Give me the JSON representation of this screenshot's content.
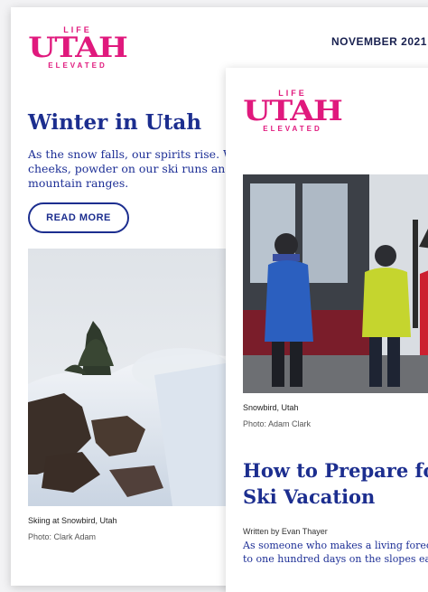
{
  "brand": {
    "life": "LIFE",
    "name": "UTAH",
    "tagline": "ELEVATED"
  },
  "newsletter": {
    "date": "NOVEMBER 2021",
    "title": "Winter in Utah",
    "intro": "As the snow falls, our spirits rise. We cheeks, powder on our ski runs and a mountain ranges.",
    "read_more": "READ MORE",
    "photo_caption": "Skiing at Snowbird, Utah",
    "photo_credit": "Photo: Clark Adam"
  },
  "article": {
    "photo_caption": "Snowbird, Utah",
    "photo_credit": "Photo: Adam Clark",
    "title_line1": "How to Prepare fo",
    "title_line2": "Ski Vacation",
    "byline": "Written by Evan Thayer",
    "body_line1": "As someone who makes a living forec",
    "body_line2": "to one hundred days on the slopes ea"
  },
  "colors": {
    "brand_pink": "#e0197d",
    "navy": "#1c2e8f"
  }
}
